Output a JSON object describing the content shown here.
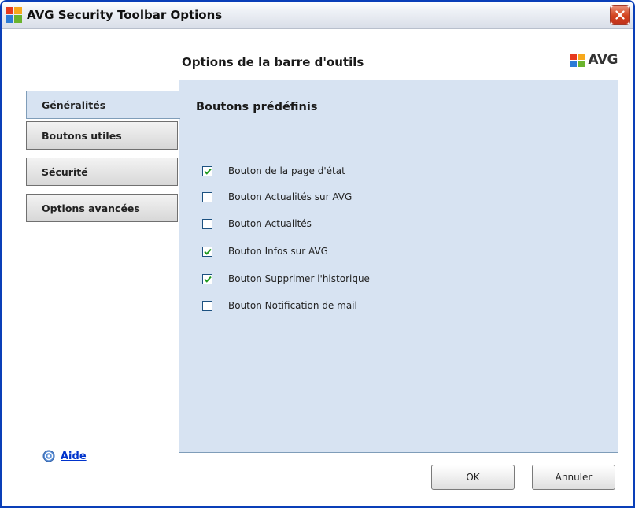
{
  "window": {
    "title": "AVG Security Toolbar Options",
    "close_icon": "close-icon"
  },
  "header": {
    "title": "Options de la barre d'outils",
    "brand": "AVG"
  },
  "tabs": [
    {
      "label": "Généralités",
      "active": true
    },
    {
      "label": "Boutons utiles",
      "active": false
    },
    {
      "label": "Sécurité",
      "active": false
    },
    {
      "label": "Options avancées",
      "active": false
    }
  ],
  "panel": {
    "title": "Boutons prédéfinis",
    "options": [
      {
        "label": "Bouton de la page d'état",
        "checked": true
      },
      {
        "label": "Bouton Actualités sur AVG",
        "checked": false
      },
      {
        "label": "Bouton Actualités",
        "checked": false
      },
      {
        "label": "Bouton Infos sur AVG",
        "checked": true
      },
      {
        "label": "Bouton Supprimer l'historique",
        "checked": true
      },
      {
        "label": "Bouton Notification de mail",
        "checked": false
      }
    ]
  },
  "help": {
    "label": "Aide",
    "icon": "help-icon"
  },
  "buttons": {
    "ok": "OK",
    "cancel": "Annuler"
  },
  "colors": {
    "panel_bg": "#d7e3f2",
    "panel_border": "#7f9db9",
    "link": "#0033cc",
    "check": "#1f9a1f",
    "close": "#d3431f"
  }
}
